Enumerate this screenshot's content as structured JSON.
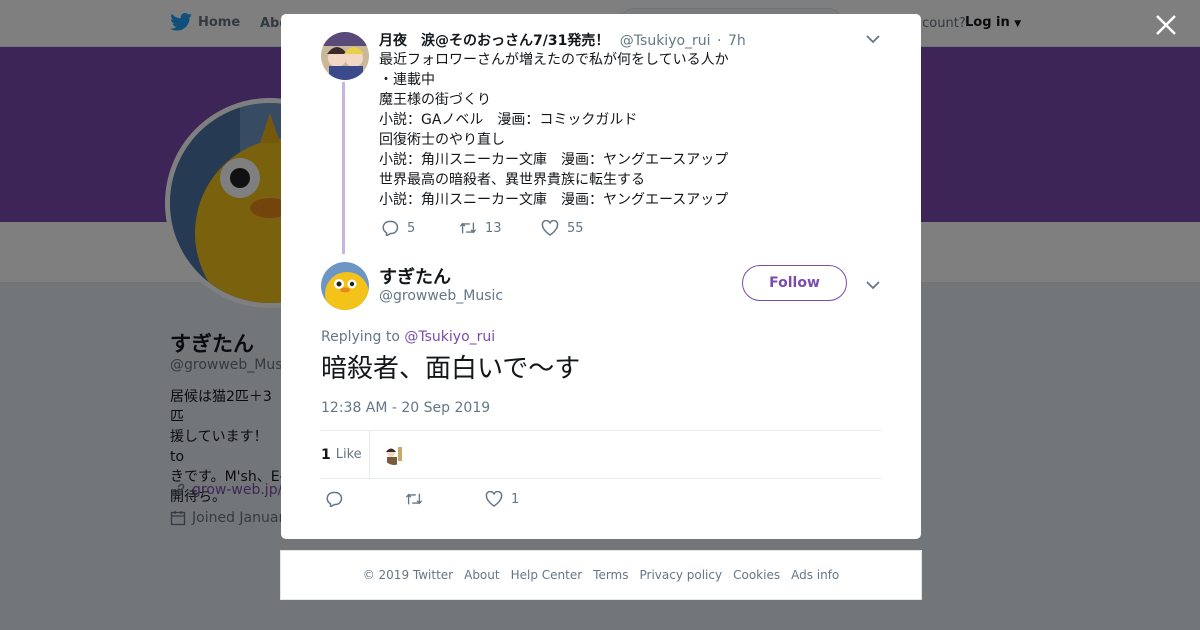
{
  "topnav": {
    "home_label": "Home",
    "about_label": "Abo",
    "account_text": "ccount?",
    "login_label": "Log in"
  },
  "profile": {
    "display_name": "すぎたん",
    "handle": "@growweb_Musi",
    "bio": "居候は猫2匹＋3匹\n援しています！ to\nきです。M'sh、E-\n開待ち。",
    "link": "grow-web.jp/m",
    "joined": "Joined Januar"
  },
  "parent_tweet": {
    "author_name": "月夜　涙@そのおっさん7/31発売！",
    "author_handle": "@Tsukiyo_rui",
    "age": "7h",
    "lines": [
      "最近フォロワーさんが増えたので私が何をしている人か",
      "・連載中",
      "魔王様の街づくり",
      "小説：GAノベル　漫画：コミックガルド",
      "回復術士のやり直し",
      "小説：角川スニーカー文庫　漫画：ヤングエースアップ",
      "世界最高の暗殺者、異世界貴族に転生する",
      "小説：角川スニーカー文庫　漫画：ヤングエースアップ"
    ],
    "reply_count": "5",
    "retweet_count": "13",
    "like_count": "55"
  },
  "main_tweet": {
    "author_name": "すぎたん",
    "author_handle": "@growweb_Music",
    "follow_label": "Follow",
    "replying_prefix": "Replying to",
    "replying_handle": "@Tsukiyo_rui",
    "text": "暗殺者、面白いで～す",
    "timestamp": "12:38 AM - 20 Sep 2019",
    "likes_count": "1",
    "likes_label": "Like",
    "action_like_count": "1"
  },
  "footer": {
    "links": [
      "© 2019 Twitter",
      "About",
      "Help Center",
      "Terms",
      "Privacy policy",
      "Cookies",
      "Ads info"
    ]
  },
  "colors": {
    "accent": "#7b4cae",
    "twitter_blue": "#1da1f2",
    "muted": "#657786"
  },
  "icons": [
    "twitter-bird-icon",
    "close-icon",
    "chevron-down-icon",
    "reply-icon",
    "retweet-icon",
    "heart-icon",
    "link-icon",
    "calendar-icon"
  ]
}
